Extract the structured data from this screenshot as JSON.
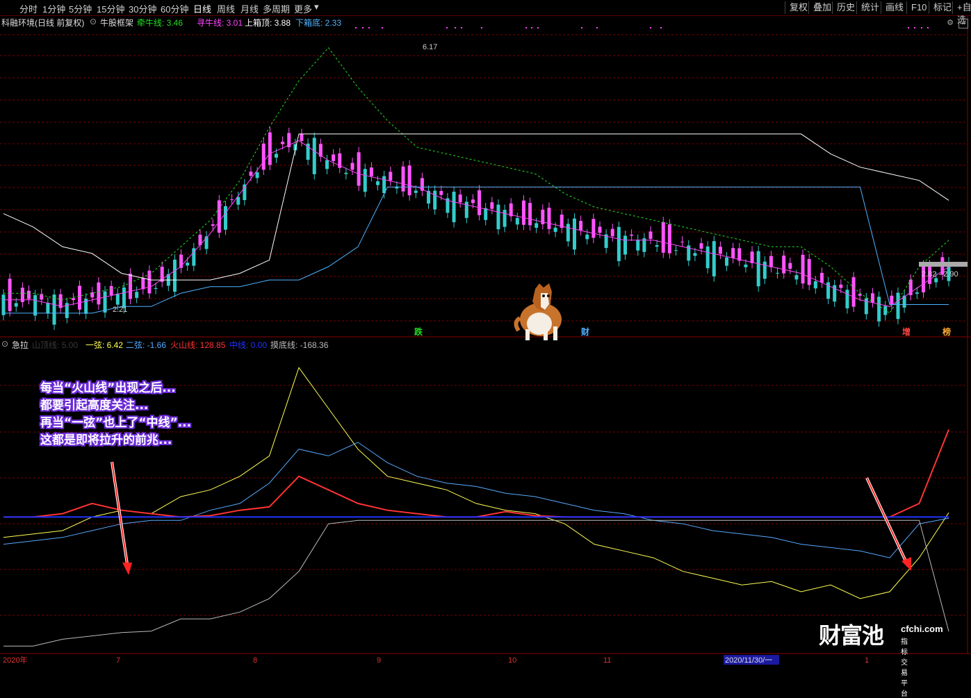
{
  "toolbar": {
    "periods": [
      "分时",
      "1分钟",
      "5分钟",
      "15分钟",
      "30分钟",
      "60分钟",
      "日线",
      "周线",
      "月线",
      "多周期",
      "更多"
    ],
    "active": "日线",
    "right": [
      "复权",
      "叠加",
      "历史",
      "统计",
      "画线",
      "F10",
      "标记",
      "+自选"
    ]
  },
  "main_header": {
    "stock": "科融环境(日线 前复权)",
    "indicator": "牛股框架",
    "items": [
      {
        "label": "牵牛线: 3.46",
        "color": "#22dd22"
      },
      {
        "label": "寻牛线: 3.01",
        "color": "#ff44ff"
      },
      {
        "label": "上箱顶: 3.88",
        "color": "#ffffff"
      },
      {
        "label": "下箱底: 2.33",
        "color": "#4fb3ff"
      }
    ]
  },
  "sub_header": {
    "name": "急拉",
    "items": [
      {
        "label": "山顶线: 5.00",
        "color": "#3a3a3a"
      },
      {
        "label": "一弦: 6.42",
        "color": "#ffff55"
      },
      {
        "label": "二弦: -1.66",
        "color": "#55aaff"
      },
      {
        "label": "火山线: 128.85",
        "color": "#ff3333"
      },
      {
        "label": "中线: 0.00",
        "color": "#2233ff"
      },
      {
        "label": "摸底线: -168.36",
        "color": "#bbbbbb"
      }
    ]
  },
  "annotation": [
    "每当“火山线”出现之后...",
    "都要引起高度关注...",
    "再当“一弦”也上了“中线”...",
    "这都是即将拉升的前兆..."
  ],
  "price_labels": {
    "high": "6.17",
    "low": "2.21",
    "current": "2.82 - 2.90"
  },
  "signals": [
    {
      "text": "跌",
      "color": "#22dd22"
    },
    {
      "text": "财",
      "color": "#4fb3ff"
    },
    {
      "text": "增",
      "color": "#ff4444"
    },
    {
      "text": "榜",
      "color": "#ffaa33"
    }
  ],
  "xaxis": {
    "labels": [
      "2020年",
      "7",
      "8",
      "9",
      "10",
      "11",
      "2020/11/30/一",
      "1"
    ]
  },
  "watermark": {
    "brand": "财富池",
    "site": "cfchi.com",
    "tag": "指标交易平台"
  },
  "chart_data": [
    {
      "type": "candlestick",
      "title": "科融环境(日线 前复权)",
      "ylim": [
        2.0,
        6.5
      ],
      "series": [
        {
          "name": "牵牛线",
          "color": "#22dd22",
          "values": [
            2.5,
            2.5,
            2.4,
            2.5,
            2.6,
            2.8,
            3.2,
            3.6,
            4.2,
            5.0,
            5.7,
            6.2,
            5.6,
            5.1,
            4.7,
            4.6,
            4.5,
            4.4,
            4.3,
            4.0,
            3.8,
            3.7,
            3.6,
            3.5,
            3.4,
            3.3,
            3.2,
            3.2,
            2.9,
            2.5,
            2.2,
            2.9,
            3.3
          ]
        },
        {
          "name": "寻牛线",
          "color": "#ff44ff",
          "values": [
            2.4,
            2.4,
            2.3,
            2.4,
            2.5,
            2.6,
            2.9,
            3.4,
            4.0,
            4.6,
            4.8,
            4.5,
            4.3,
            4.2,
            4.1,
            3.9,
            3.8,
            3.7,
            3.6,
            3.5,
            3.4,
            3.3,
            3.3,
            3.2,
            3.1,
            3.0,
            2.9,
            2.8,
            2.6,
            2.4,
            2.3,
            2.6,
            2.9
          ]
        },
        {
          "name": "上箱顶",
          "color": "#ffffff",
          "values": [
            3.7,
            3.5,
            3.2,
            3.1,
            2.8,
            2.7,
            2.7,
            2.7,
            2.8,
            3.0,
            4.9,
            4.9,
            4.9,
            4.9,
            4.9,
            4.9,
            4.9,
            4.9,
            4.9,
            4.9,
            4.9,
            4.9,
            4.9,
            4.9,
            4.9,
            4.9,
            4.9,
            4.9,
            4.6,
            4.4,
            4.3,
            4.2,
            3.9
          ]
        },
        {
          "name": "下箱底",
          "color": "#4fb3ff",
          "values": [
            2.2,
            2.2,
            2.2,
            2.2,
            2.3,
            2.3,
            2.5,
            2.6,
            2.6,
            2.7,
            2.7,
            2.9,
            3.2,
            4.1,
            4.1,
            4.1,
            4.1,
            4.1,
            4.1,
            4.1,
            4.1,
            4.1,
            4.1,
            4.1,
            4.1,
            4.1,
            4.1,
            4.1,
            4.1,
            4.1,
            2.33,
            2.33,
            2.33
          ]
        }
      ]
    },
    {
      "type": "line",
      "title": "急拉",
      "ylim": [
        -200,
        250
      ],
      "series": [
        {
          "name": "一弦",
          "color": "#ffff55",
          "values": [
            -30,
            -25,
            -20,
            0,
            10,
            5,
            30,
            40,
            60,
            90,
            220,
            160,
            100,
            60,
            50,
            40,
            20,
            10,
            5,
            -10,
            -40,
            -50,
            -60,
            -80,
            -90,
            -100,
            -95,
            -110,
            -100,
            -120,
            -110,
            -60,
            6.42
          ]
        },
        {
          "name": "二弦",
          "color": "#55aaff",
          "values": [
            -40,
            -35,
            -30,
            -20,
            -10,
            -5,
            -5,
            10,
            20,
            50,
            100,
            90,
            110,
            80,
            60,
            50,
            45,
            35,
            30,
            20,
            10,
            5,
            -5,
            -10,
            -20,
            -25,
            -30,
            -40,
            -45,
            -50,
            -60,
            -10,
            -1.66
          ]
        },
        {
          "name": "火山线",
          "color": "#ff3333",
          "values": [
            0,
            0,
            5,
            20,
            10,
            5,
            0,
            2,
            10,
            15,
            60,
            40,
            20,
            10,
            5,
            0,
            0,
            8,
            2,
            0,
            0,
            0,
            0,
            0,
            0,
            0,
            0,
            0,
            0,
            0,
            0,
            20,
            128.85
          ]
        },
        {
          "name": "中线",
          "color": "#2233ff",
          "values": [
            0,
            0,
            0,
            0,
            0,
            0,
            0,
            0,
            0,
            0,
            0,
            0,
            0,
            0,
            0,
            0,
            0,
            0,
            0,
            0,
            0,
            0,
            0,
            0,
            0,
            0,
            0,
            0,
            0,
            0,
            0,
            0,
            0
          ]
        },
        {
          "name": "摸底线",
          "color": "#bbbbbb",
          "values": [
            -190,
            -190,
            -180,
            -175,
            -170,
            -168,
            -150,
            -150,
            -140,
            -120,
            -80,
            -10,
            -5,
            -5,
            -5,
            -5,
            -5,
            -5,
            -5,
            -5,
            -5,
            -5,
            -5,
            -5,
            -5,
            -5,
            -5,
            -5,
            -5,
            -5,
            -5,
            -5,
            -168.36
          ]
        }
      ]
    }
  ]
}
